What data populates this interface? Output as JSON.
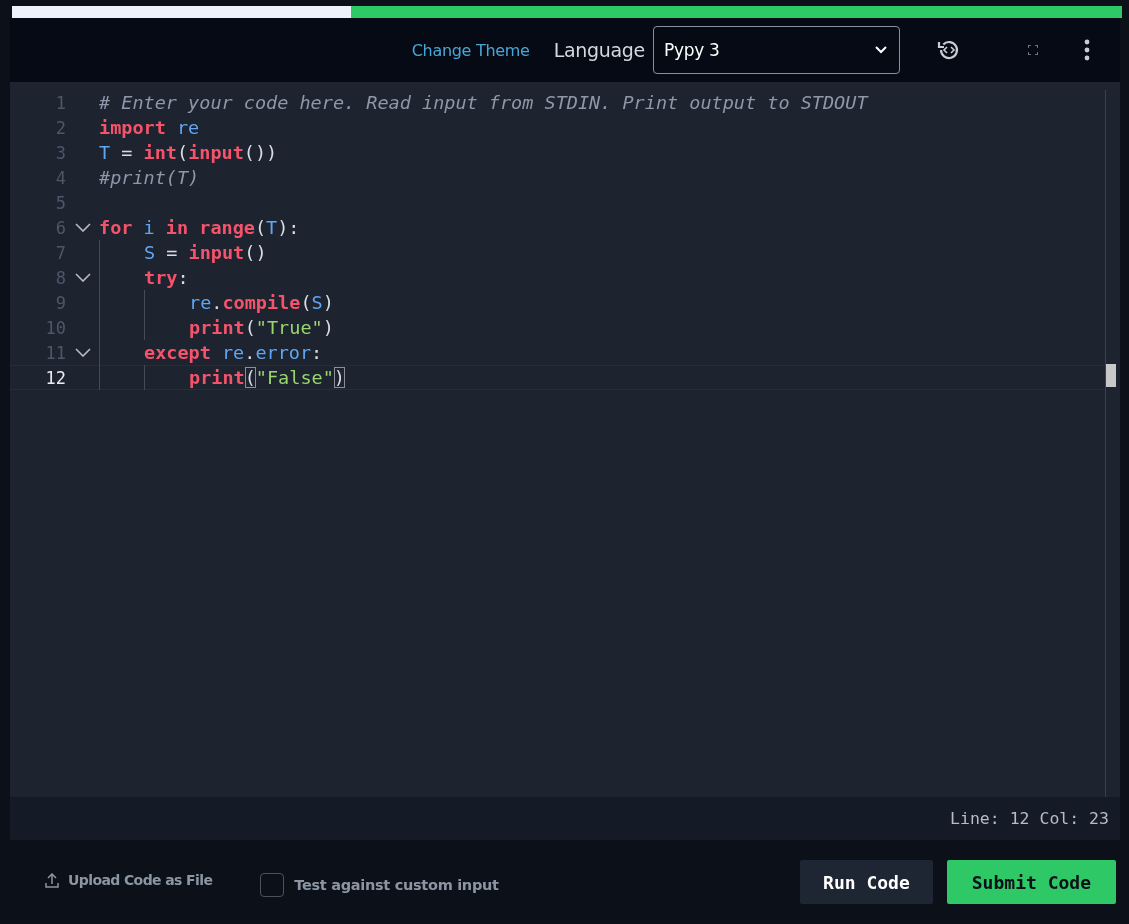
{
  "progress": {
    "level": 0.305
  },
  "header": {
    "change_theme": "Change Theme",
    "language_label": "Language",
    "language_select": {
      "value": "Pypy 3"
    }
  },
  "editor": {
    "lines": [
      {
        "number": "1",
        "current": false,
        "tokens": [
          {
            "kind": "comment",
            "text": "# Enter your code here. Read input from STDIN. Print output to STDOUT"
          }
        ]
      },
      {
        "number": "2",
        "current": false,
        "tokens": [
          {
            "kind": "keyword",
            "text": "import "
          },
          {
            "kind": "name",
            "text": "re"
          }
        ]
      },
      {
        "number": "3",
        "current": false,
        "tokens": [
          {
            "kind": "name",
            "text": "T"
          },
          {
            "kind": "plain",
            "text": " = "
          },
          {
            "kind": "keyword",
            "text": "int"
          },
          {
            "kind": "plain",
            "text": "("
          },
          {
            "kind": "keyword",
            "text": "input"
          },
          {
            "kind": "plain",
            "text": "())"
          }
        ]
      },
      {
        "number": "4",
        "current": false,
        "tokens": [
          {
            "kind": "comment",
            "text": "#print(T)"
          }
        ]
      },
      {
        "number": "5",
        "current": false
      },
      {
        "number": "6",
        "current": false,
        "tokens": [
          {
            "kind": "keyword",
            "text": "for "
          },
          {
            "kind": "name",
            "text": "i "
          },
          {
            "kind": "keyword",
            "text": "in range"
          },
          {
            "kind": "plain",
            "text": "("
          },
          {
            "kind": "name",
            "text": "T"
          },
          {
            "kind": "plain",
            "text": "):"
          }
        ],
        "children": [
          {
            "number": "7",
            "current": false,
            "tokens": [
              {
                "kind": "name",
                "text": "S"
              },
              {
                "kind": "plain",
                "text": " = "
              },
              {
                "kind": "keyword",
                "text": "input"
              },
              {
                "kind": "plain",
                "text": "()"
              }
            ]
          },
          {
            "number": "8",
            "current": false,
            "tokens": [
              {
                "kind": "keyword",
                "text": "try"
              },
              {
                "kind": "plain",
                "text": ":"
              }
            ],
            "children": [
              {
                "number": "9",
                "current": false,
                "tokens": [
                  {
                    "kind": "name",
                    "text": "re"
                  },
                  {
                    "kind": "plain",
                    "text": "."
                  },
                  {
                    "kind": "keyword",
                    "text": "compile"
                  },
                  {
                    "kind": "plain",
                    "text": "("
                  },
                  {
                    "kind": "name",
                    "text": "S"
                  },
                  {
                    "kind": "plain",
                    "text": ")"
                  }
                ]
              },
              {
                "number": "10",
                "current": false,
                "tokens": [
                  {
                    "kind": "keyword",
                    "text": "print"
                  },
                  {
                    "kind": "plain",
                    "text": "("
                  },
                  {
                    "kind": "string",
                    "text": "\"True\""
                  },
                  {
                    "kind": "plain",
                    "text": ")"
                  }
                ]
              }
            ]
          },
          {
            "number": "11",
            "current": false,
            "tokens": [
              {
                "kind": "keyword",
                "text": "except "
              },
              {
                "kind": "name",
                "text": "re"
              },
              {
                "kind": "plain",
                "text": "."
              },
              {
                "kind": "name",
                "text": "error"
              },
              {
                "kind": "plain",
                "text": ":"
              }
            ],
            "children": [
              {
                "number": "12",
                "current": true,
                "tokens": [
                  {
                    "kind": "keyword",
                    "text": "print"
                  },
                  {
                    "kind": "bracket",
                    "text": "("
                  },
                  {
                    "kind": "string",
                    "text": "\"False\""
                  },
                  {
                    "kind": "bracket",
                    "text": ")"
                  }
                ]
              }
            ]
          }
        ]
      }
    ]
  },
  "status": "Line: 12 Col: 23",
  "footer": {
    "upload": "Upload Code as File",
    "custom_input": {
      "label": "Test against custom input",
      "checked": false
    },
    "buttons": [
      {
        "label": "Run Code",
        "kind": "secondary"
      },
      {
        "label": "Submit Code",
        "kind": "primary"
      }
    ]
  }
}
